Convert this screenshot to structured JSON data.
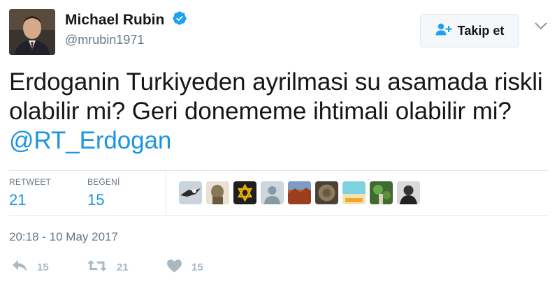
{
  "author": {
    "name": "Michael Rubin",
    "handle": "@mrubin1971",
    "verified_icon": "verified-badge-icon"
  },
  "follow_button": {
    "label": "Takip et",
    "icon": "add-user-icon"
  },
  "menu_icon": "chevron-down-icon",
  "tweet": {
    "text_plain": "Erdoganin Turkiyeden ayrilmasi su asamada riskli olabilir mi? Geri donememe ihtimali olabilir mi? ",
    "mention": "@RT_Erdogan"
  },
  "stats": {
    "retweet_label": "RETWEET",
    "retweet_count": "21",
    "like_label": "BEĞENİ",
    "like_count": "15"
  },
  "likers_count_shown": 9,
  "timestamp": "20:18 - 10 May 2017",
  "actions": {
    "reply_count": "15",
    "retweet_count": "21",
    "like_count": "15"
  },
  "colors": {
    "link": "#1b95e0",
    "secondary_text": "#657786",
    "action_icons": "#aab8c2",
    "divider": "#e1e8ed"
  }
}
